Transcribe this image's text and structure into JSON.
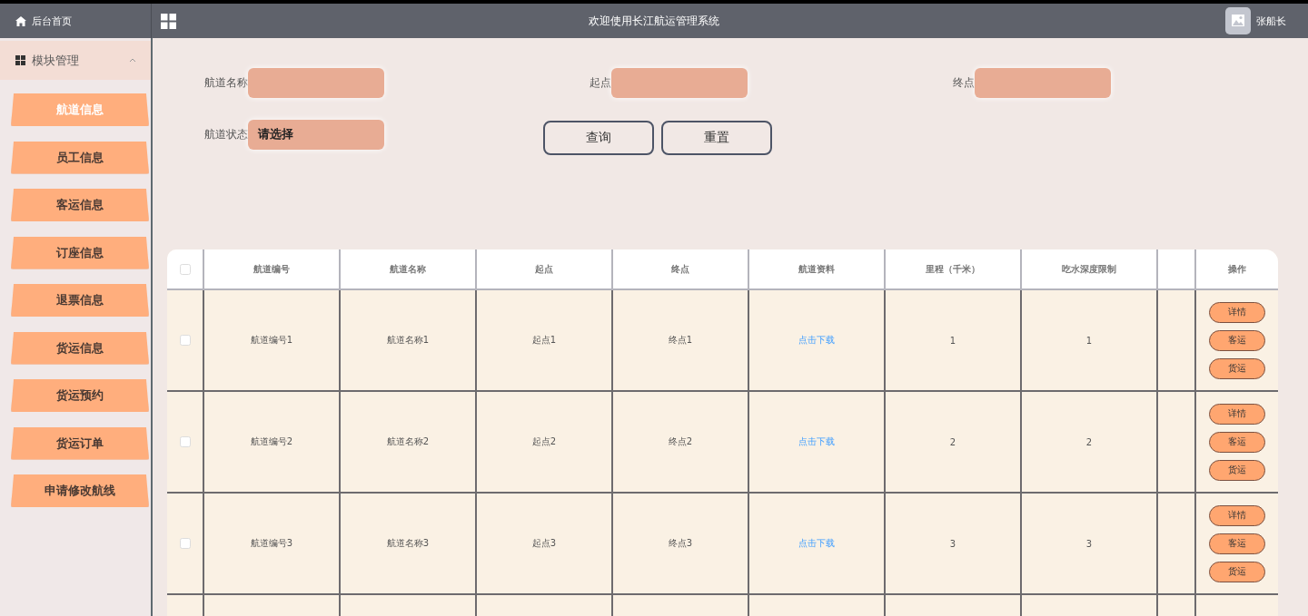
{
  "header": {
    "home": "后台首页",
    "title": "欢迎使用长江航运管理系统",
    "user": "张船长"
  },
  "sidebar": {
    "group": {
      "label": "模块管理",
      "expanded": true
    },
    "items": [
      {
        "label": "航道信息",
        "selected": true
      },
      {
        "label": "员工信息",
        "selected": false
      },
      {
        "label": "客运信息",
        "selected": false
      },
      {
        "label": "订座信息",
        "selected": false
      },
      {
        "label": "退票信息",
        "selected": false
      },
      {
        "label": "货运信息",
        "selected": false
      },
      {
        "label": "货运预约",
        "selected": false
      },
      {
        "label": "货运订单",
        "selected": false
      },
      {
        "label": "申请修改航线",
        "selected": false
      }
    ]
  },
  "search": {
    "fields": [
      {
        "label": "航道名称",
        "kind": "input"
      },
      {
        "label": "起点",
        "kind": "input"
      },
      {
        "label": "终点",
        "kind": "input"
      },
      {
        "label": "航道状态",
        "kind": "select",
        "value": "请选择"
      }
    ],
    "buttons": [
      "查询",
      "重置"
    ]
  },
  "table": {
    "select_all": {
      "checked": false
    },
    "columns": [
      "航道编号",
      "航道名称",
      "起点",
      "终点",
      "航道资料",
      "里程（千米）",
      "吃水深度限制",
      "操作"
    ],
    "rows": [
      {
        "checked": false,
        "cells": [
          "航道编号1",
          "航道名称1",
          "起点1",
          "终点1"
        ],
        "link": "点击下载",
        "mileage": "1",
        "draft": "1",
        "actions": [
          "详情",
          "客运",
          "货运"
        ]
      },
      {
        "checked": false,
        "cells": [
          "航道编号2",
          "航道名称2",
          "起点2",
          "终点2"
        ],
        "link": "点击下载",
        "mileage": "2",
        "draft": "2",
        "actions": [
          "详情",
          "客运",
          "货运"
        ]
      },
      {
        "checked": false,
        "cells": [
          "航道编号3",
          "航道名称3",
          "起点3",
          "终点3"
        ],
        "link": "点击下载",
        "mileage": "3",
        "draft": "3",
        "actions": [
          "详情",
          "客运",
          "货运"
        ]
      }
    ]
  }
}
